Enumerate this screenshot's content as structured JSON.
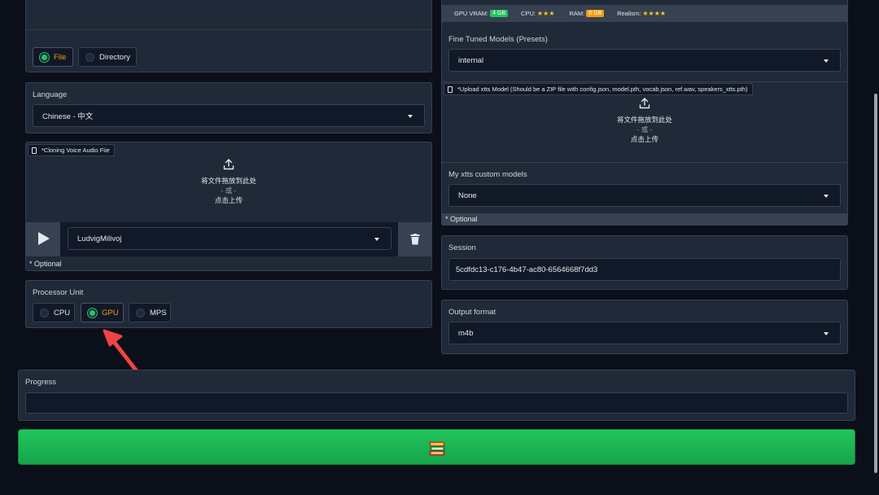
{
  "left": {
    "input_mode": {
      "options": [
        {
          "label": "File",
          "selected": true
        },
        {
          "label": "Directory",
          "selected": false
        }
      ]
    },
    "language": {
      "label": "Language",
      "value": "Chinese - 中文"
    },
    "cloning_voice": {
      "file_label": "*Cloning Voice Audio Fiie",
      "drop_text": "将文件拖放到此处",
      "or_text": "- 或 -",
      "click_text": "点击上传",
      "voice_value": "LudvigMilivoj",
      "optional": "* Optional"
    },
    "processor": {
      "label": "Processor Unit",
      "options": [
        {
          "label": "CPU",
          "selected": false
        },
        {
          "label": "GPU",
          "selected": true
        },
        {
          "label": "MPS",
          "selected": false
        }
      ]
    }
  },
  "right": {
    "specs": {
      "gpu_label": "GPU VRAM:",
      "gpu_badge": "4 GB",
      "cpu_label": "CPU:",
      "cpu_stars": "★★★",
      "ram_label": "RAM:",
      "ram_badge": "8 GB",
      "realism_label": "Realism:",
      "realism_stars": "★★★★"
    },
    "fine_tuned": {
      "label": "Fine Tuned Models (Presets)",
      "value": "internal"
    },
    "xtts_upload": {
      "file_label": "*Upload xtts Model (Should be a ZIP file with config.json, model.pth, vocab.json, ref.wav, speakers_xtts.pth)",
      "drop_text": "将文件拖放到此处",
      "or_text": "- 或 -",
      "click_text": "点击上传"
    },
    "custom_models": {
      "label": "My xtts custom models",
      "value": "None",
      "optional": "* Optional"
    },
    "session": {
      "label": "Session",
      "value": "5cdfdc13-c176-4b47-ac80-6564668f7dd3"
    },
    "output_format": {
      "label": "Output format",
      "value": "m4b"
    }
  },
  "progress": {
    "label": "Progress",
    "value": ""
  },
  "colors": {
    "background": "#0b0f19",
    "panel": "#1f2937",
    "accent_orange": "#f59e0b",
    "selected_green": "#22c55e",
    "convert_button": "#22c55e",
    "arrow_red": "#ef4444"
  },
  "convert_button": {
    "icon": "books-icon"
  }
}
